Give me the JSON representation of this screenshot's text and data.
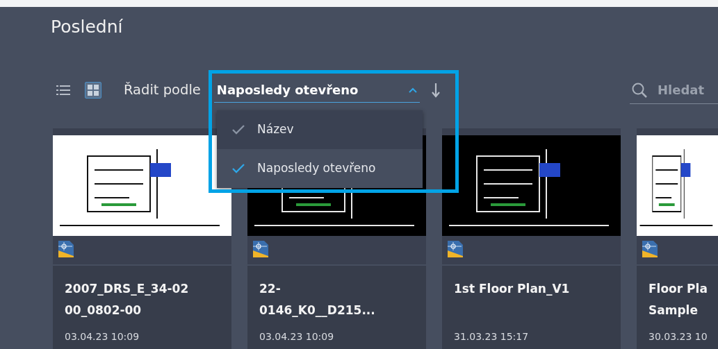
{
  "page": {
    "title": "Poslední"
  },
  "toolbar": {
    "views": [
      {
        "kind": "list",
        "selected": false
      },
      {
        "kind": "grid",
        "selected": true
      }
    ],
    "sort_label": "Řadit podle",
    "sort_value": "Naposledy otevřeno",
    "sort_open": true,
    "sort_options": [
      {
        "label": "Název",
        "selected": false
      },
      {
        "label": "Naposledy otevřeno",
        "selected": true
      }
    ],
    "search": {
      "placeholder": "Hledat"
    }
  },
  "files": [
    {
      "name": "2007_DRS_E_34-02 00_0802-00",
      "date": "03.04.23 10:09",
      "kind": "light"
    },
    {
      "name": "22-0146_K0__D215...",
      "date": "03.04.23 10:09",
      "kind": "dark"
    },
    {
      "name": "1st Floor Plan_V1",
      "date": "31.03.23 15:17",
      "kind": "dark"
    },
    {
      "name": "Floor Pla Sample",
      "date": "30.03.23 10",
      "kind": "light"
    }
  ]
}
